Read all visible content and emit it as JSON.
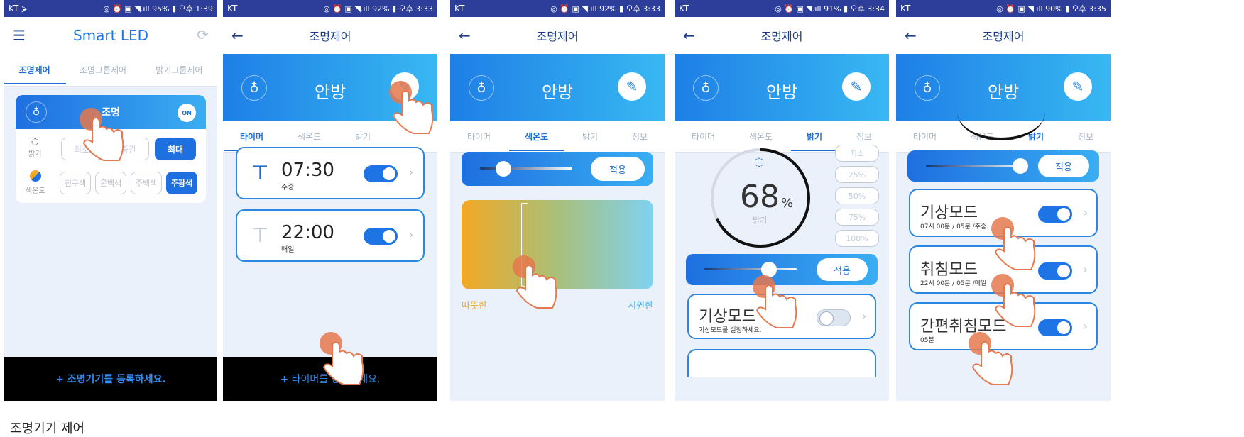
{
  "colors": {
    "status_bar": "#2c3e99",
    "accent": "#1e74e4",
    "header_gradient": [
      "#1e7fe6",
      "#38b8f2"
    ],
    "footer": "#000000",
    "footer_text": "#2f8cf0",
    "warm": "#f3a825",
    "cool": "#7fd2f2"
  },
  "status": [
    {
      "carrier": "KT ⮚",
      "right": "◎ ⏰ ▣ ◥.ıll 95% ▮ 오후 1:39"
    },
    {
      "carrier": "KT",
      "right": "◎ ⏰ ▣ ◥.ıll 92% ▮ 오후 3:33"
    },
    {
      "carrier": "KT",
      "right": "◎ ⏰ ▣ ◥.ıll 92% ▮ 오후 3:33"
    },
    {
      "carrier": "KT",
      "right": "◎ ⏰ ▣ ◥.ıll 91% ▮ 오후 3:34"
    },
    {
      "carrier": "KT",
      "right": "◎ ⏰ ▣ ◥.ıll 90% ▮ 오후 3:35"
    }
  ],
  "s1": {
    "menu_icon": "☰",
    "title": "Smart LED",
    "refresh_icon": "⟳",
    "tabs": [
      "조명제어",
      "조명그룹제어",
      "밝기그룹제어"
    ],
    "light_name": "조명",
    "on_badge": "ON",
    "brightness_label": "밝기",
    "brightness_btns": [
      "최소",
      "중간",
      "최대"
    ],
    "color_label": "색온도",
    "color_btns": [
      "전구색",
      "온백색",
      "주백색",
      "주광색"
    ],
    "footer": "+ 조명기기를 등록하세요."
  },
  "detail": {
    "back": "←",
    "title": "조명제어",
    "room": "안방",
    "bulb_icon": "♁",
    "edit_icon": "✎",
    "tabs": [
      "타이머",
      "색온도",
      "밝기",
      "정보"
    ]
  },
  "s2": {
    "timers": [
      {
        "time": "07:30",
        "repeat": "주중",
        "on": true
      },
      {
        "time": "22:00",
        "repeat": "매일",
        "on": true
      }
    ],
    "footer": "+ 타이머를 등록하세요."
  },
  "s3": {
    "apply": "적용",
    "warm": "따뜻한",
    "cool": "시원한",
    "slider_value": 0.25
  },
  "s4": {
    "brightness": "68",
    "unit": "%",
    "label": "밝기",
    "level": 0.68,
    "presets": [
      "최소",
      "25%",
      "50%",
      "75%",
      "100%"
    ],
    "apply": "적용",
    "slider_value": 0.7,
    "mode": {
      "name": "기상모드",
      "desc": "기상모드를 설정하세요.",
      "on": false
    }
  },
  "s5": {
    "apply": "적용",
    "slider_value": 0.95,
    "modes": [
      {
        "name": "기상모드",
        "desc": "07시 00분 / 05분 /주중",
        "on": true
      },
      {
        "name": "취침모드",
        "desc": "22시 00분 / 05분 /매일",
        "on": true
      },
      {
        "name": "간편취침모드",
        "desc": "05분",
        "on": true
      }
    ]
  },
  "caption": "조명기기 제어"
}
